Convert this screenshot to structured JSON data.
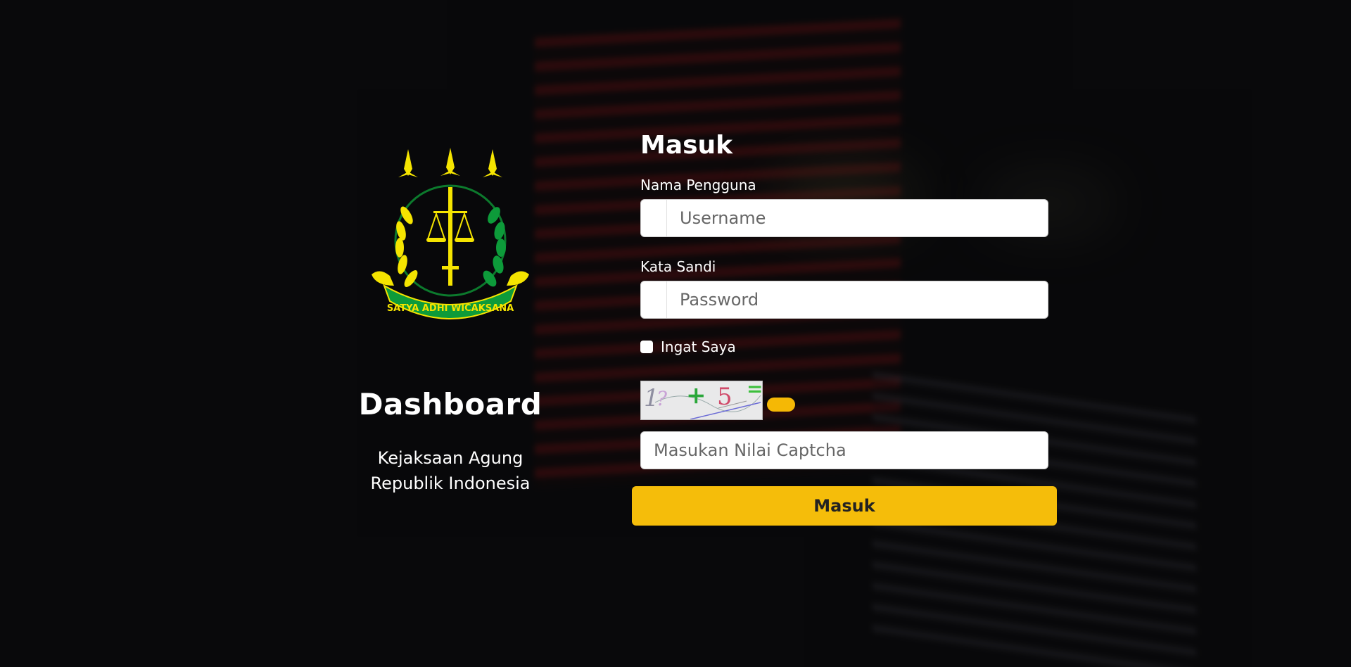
{
  "brand": {
    "title": "Dashboard",
    "subtitle_line1": "Kejaksaan Agung",
    "subtitle_line2": "Republik Indonesia",
    "emblem_motto": "SATYA ADHI WICAKSANA"
  },
  "form": {
    "title": "Masuk",
    "username_label": "Nama Pengguna",
    "username_placeholder": "Username",
    "username_value": "",
    "password_label": "Kata Sandi",
    "password_placeholder": "Password",
    "password_value": "",
    "remember_label": "Ingat Saya",
    "remember_checked": false,
    "captcha_chars": [
      "1",
      "?",
      "+",
      "5",
      "="
    ],
    "captcha_placeholder": "Masukan Nilai Captcha",
    "captcha_value": "",
    "submit_label": "Masuk"
  },
  "colors": {
    "accent": "#f5bd0a",
    "background": "#0b0b0c",
    "text": "#ffffff",
    "emblem_green": "#0d9b3a",
    "emblem_yellow": "#f5e400"
  }
}
